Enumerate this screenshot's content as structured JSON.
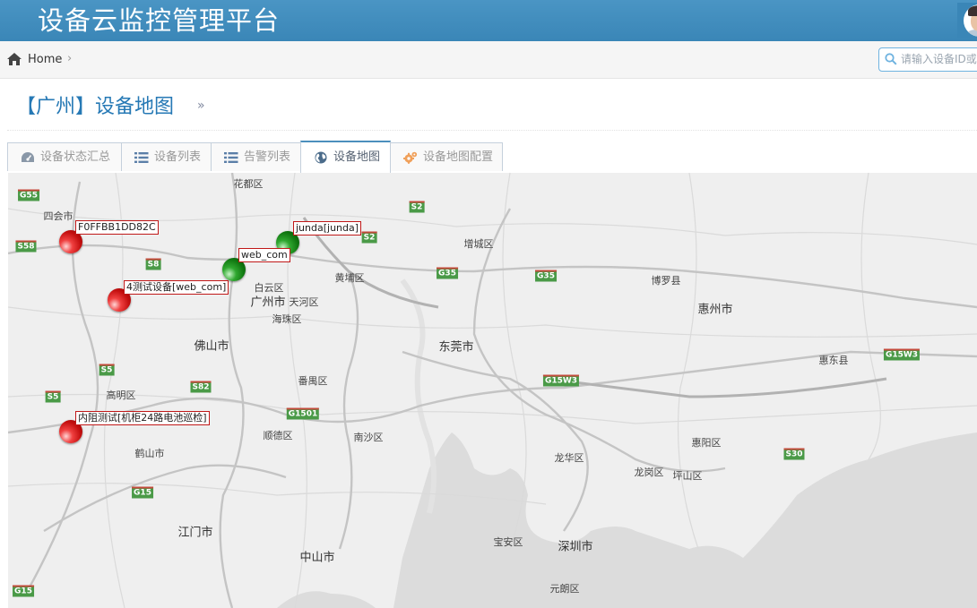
{
  "header": {
    "title": "设备云监控管理平台"
  },
  "breadcrumb": {
    "home_label": "Home",
    "separator": "›"
  },
  "search": {
    "placeholder": "请输入设备ID或",
    "value": ""
  },
  "page": {
    "title": "【广州】设备地图",
    "title_suffix": "»"
  },
  "tabs": [
    {
      "label": "设备状态汇总",
      "icon": "tachometer-icon",
      "active": false
    },
    {
      "label": "设备列表",
      "icon": "list-icon",
      "active": false
    },
    {
      "label": "告警列表",
      "icon": "list-icon",
      "active": false
    },
    {
      "label": "设备地图",
      "icon": "globe-icon",
      "active": true
    },
    {
      "label": "设备地图配置",
      "icon": "cogs-icon",
      "active": false
    }
  ],
  "map": {
    "places": [
      {
        "name": "花都区"
      },
      {
        "name": "四会市"
      },
      {
        "name": "增城区"
      },
      {
        "name": "黄埔区"
      },
      {
        "name": "白云区"
      },
      {
        "name": "广州市"
      },
      {
        "name": "天河区"
      },
      {
        "name": "海珠区"
      },
      {
        "name": "博罗县"
      },
      {
        "name": "惠州市"
      },
      {
        "name": "佛山市"
      },
      {
        "name": "东莞市"
      },
      {
        "name": "惠东县"
      },
      {
        "name": "高明区"
      },
      {
        "name": "番禺区"
      },
      {
        "name": "顺德区"
      },
      {
        "name": "南沙区"
      },
      {
        "name": "惠阳区"
      },
      {
        "name": "龙华区"
      },
      {
        "name": "龙岗区"
      },
      {
        "name": "坪山区"
      },
      {
        "name": "鹤山市"
      },
      {
        "name": "江门市"
      },
      {
        "name": "中山市"
      },
      {
        "name": "宝安区"
      },
      {
        "name": "深圳市"
      },
      {
        "name": "元朗区"
      }
    ],
    "highways": [
      "G55",
      "S2",
      "S58",
      "S2",
      "S8",
      "G35",
      "G35",
      "S5",
      "S82",
      "G15W3",
      "G15W3",
      "S5",
      "G1501",
      "S30",
      "G15",
      "G15"
    ],
    "devices": [
      {
        "label": "F0FFBB1DD82C",
        "status": "alarm",
        "color": "#d01818"
      },
      {
        "label": "junda[junda]",
        "status": "normal",
        "color": "#1b8a1b"
      },
      {
        "label": "web_com",
        "status": "normal",
        "color": "#1b8a1b"
      },
      {
        "label": "4测试设备[web_com]",
        "status": "alarm",
        "color": "#d01818"
      },
      {
        "label": "内阻测试[机柜24路电池巡检]",
        "status": "alarm",
        "color": "#d01818"
      }
    ]
  },
  "colors": {
    "header_bg": "#3c8dbc",
    "title_blue": "#2679b5",
    "alarm": "#d01818",
    "normal": "#1b8a1b"
  }
}
